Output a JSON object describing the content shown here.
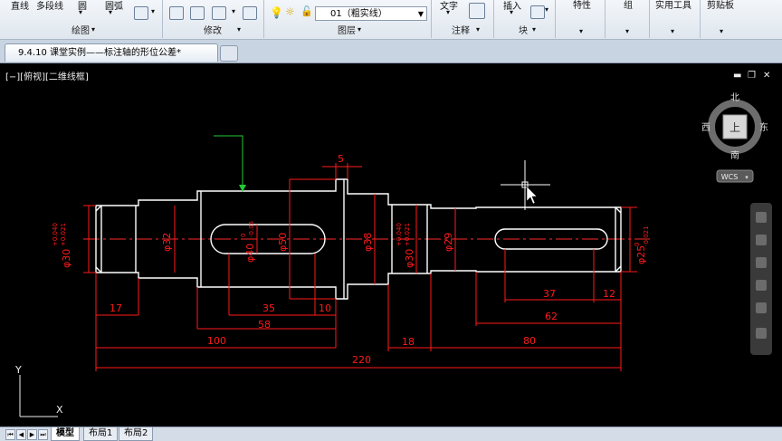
{
  "ribbon": {
    "draw_tools": [
      "直线",
      "多段线",
      "圆",
      "圆弧"
    ],
    "panels": {
      "draw": "绘图",
      "modify": "修改",
      "layer": "图层",
      "annotation": "注释",
      "block": "块"
    },
    "layer_combo_value": "01（粗实线）",
    "buttons": {
      "text": "文字",
      "insert": "插入",
      "properties": "特性",
      "group": "组",
      "utilities": "实用工具",
      "clipboard": "剪贴板"
    }
  },
  "document": {
    "tab_title": "9.4.10 课堂实例——标注轴的形位公差*"
  },
  "viewport": {
    "label": "[−][俯视][二维线框]",
    "viewcube": {
      "north": "北",
      "south": "南",
      "east": "东",
      "west": "西",
      "face": "上",
      "wcs": "WCS"
    },
    "ucs": {
      "x": "X",
      "y": "Y"
    }
  },
  "drawing": {
    "dims": {
      "d30_left": "φ30",
      "tol_left_upper": "+0.040",
      "tol_left_lower": "+0.021",
      "d32": "φ32",
      "d40": "φ40",
      "tol_d40_upper": "0",
      "tol_d40_lower": "-0.05",
      "d50": "φ50",
      "d38": "φ38",
      "d30_right": "φ30",
      "tol_right_upper": "+0.040",
      "tol_right_lower": "+0.021",
      "d29": "φ29",
      "d25": "φ25",
      "tol_d25_upper": "0",
      "tol_d25_lower": "-0.021",
      "w5": "5",
      "l17": "17",
      "l35": "35",
      "l10": "10",
      "l58": "58",
      "l100": "100",
      "l18": "18",
      "l80": "80",
      "l220": "220",
      "l37": "37",
      "l12": "12",
      "l62": "62"
    }
  },
  "layout_tabs": [
    "模型",
    "布局1",
    "布局2"
  ],
  "colors": {
    "dimension": "#ff1a1a",
    "geometry": "#ffffff",
    "leader": "#22cc33",
    "background": "#000000"
  }
}
